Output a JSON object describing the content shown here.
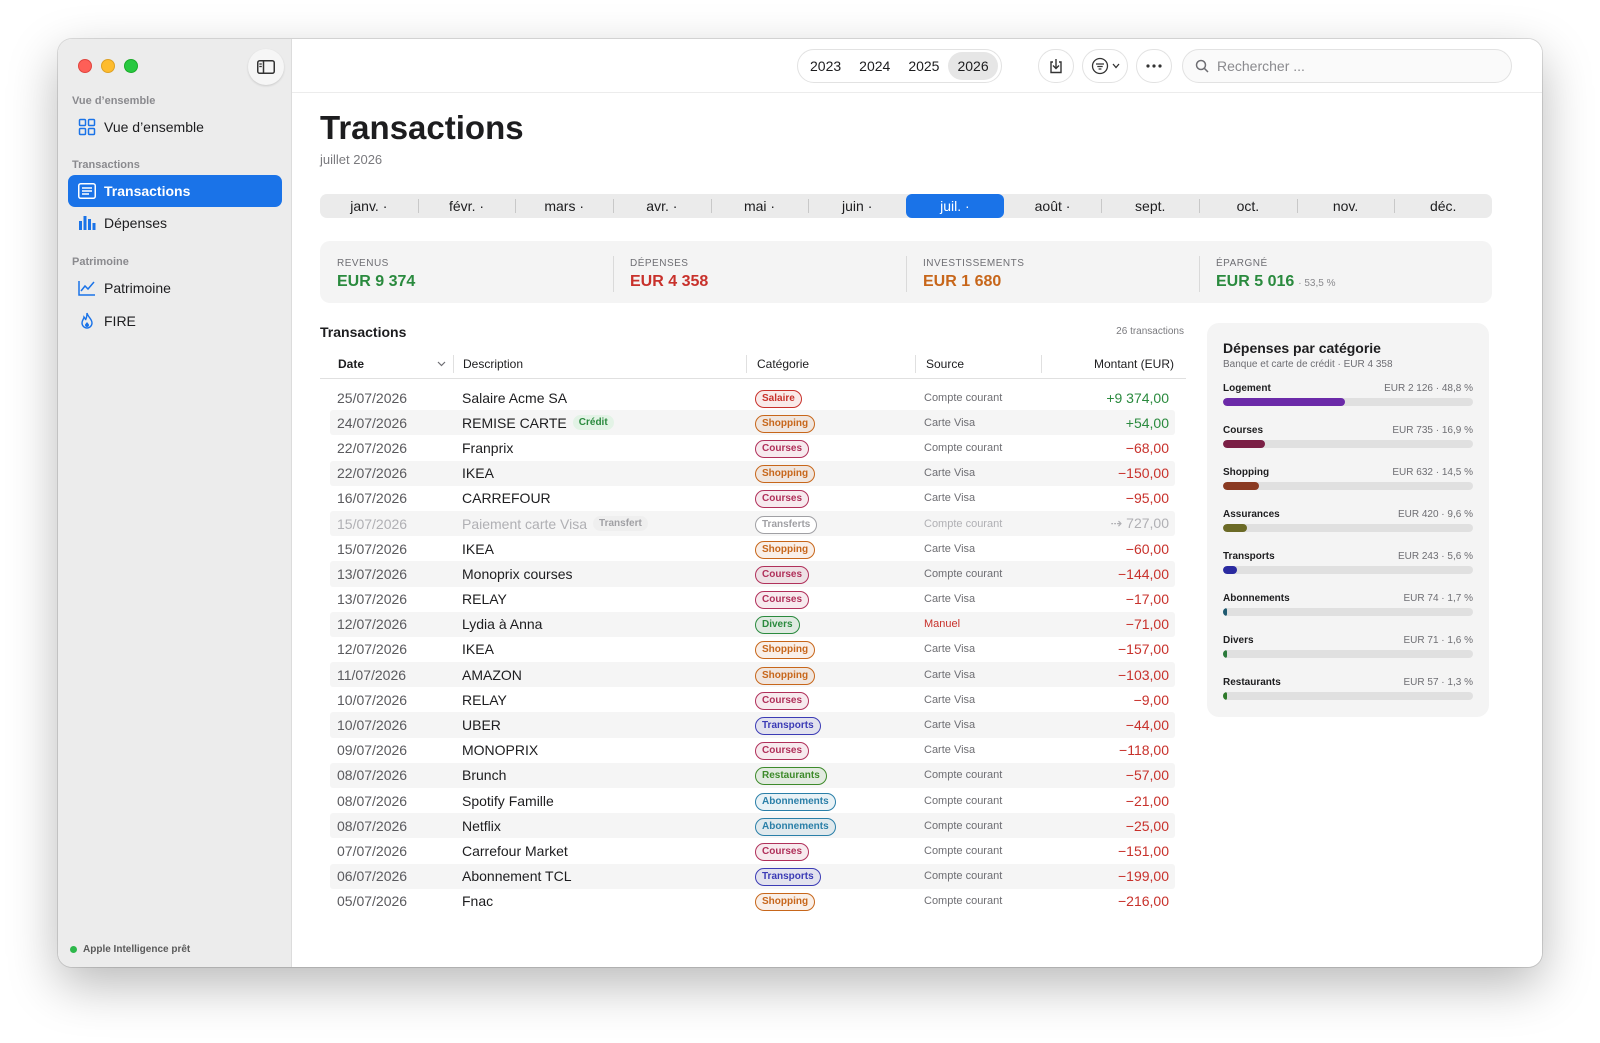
{
  "window": {
    "sidebar": {
      "sections": [
        {
          "label": "Vue d’ensemble",
          "items": [
            {
              "label": "Vue d’ensemble",
              "icon": "grid-icon"
            }
          ]
        },
        {
          "label": "Transactions",
          "items": [
            {
              "label": "Transactions",
              "icon": "list-icon",
              "active": true
            },
            {
              "label": "Dépenses",
              "icon": "bar-chart-icon"
            }
          ]
        },
        {
          "label": "Patrimoine",
          "items": [
            {
              "label": "Patrimoine",
              "icon": "line-chart-icon"
            },
            {
              "label": "FIRE",
              "icon": "flame-icon"
            }
          ]
        }
      ],
      "status": "Apple Intelligence prêt"
    },
    "toolbar": {
      "years": [
        "2023",
        "2024",
        "2025",
        "2026"
      ],
      "selected_year": "2026",
      "search_placeholder": "Rechercher ..."
    }
  },
  "page": {
    "title": "Transactions",
    "subtitle": "juillet 2026",
    "months": [
      "janv. ·",
      "févr. ·",
      "mars ·",
      "avr. ·",
      "mai ·",
      "juin ·",
      "juil. ·",
      "août ·",
      "sept.",
      "oct.",
      "nov.",
      "déc."
    ],
    "selected_month": "juil. ·"
  },
  "kpis": [
    {
      "label": "REVENUS",
      "value": "EUR 9 374",
      "color": "#2a8a3e",
      "extra": ""
    },
    {
      "label": "DÉPENSES",
      "value": "EUR 4 358",
      "color": "#c8312b",
      "extra": ""
    },
    {
      "label": "INVESTISSEMENTS",
      "value": "EUR 1 680",
      "color": "#c7661a",
      "extra": ""
    },
    {
      "label": "ÉPARGNÉ",
      "value": "EUR 5 016",
      "color": "#2a8a3e",
      "extra": "· 53,5 %"
    }
  ],
  "transactions": {
    "title": "Transactions",
    "count": "26 transactions",
    "columns": {
      "date": "Date",
      "description": "Description",
      "category": "Catégorie",
      "source": "Source",
      "amount": "Montant (EUR)"
    },
    "rows": [
      {
        "date": "25/07/2026",
        "desc": "Salaire Acme SA",
        "tag": "",
        "cat": "Salaire",
        "src": "Compte courant",
        "amt": "+9 374,00",
        "type": "in"
      },
      {
        "date": "24/07/2026",
        "desc": "REMISE CARTE",
        "tag": "Crédit",
        "cat": "Shopping",
        "src": "Carte Visa",
        "amt": "+54,00",
        "type": "in"
      },
      {
        "date": "22/07/2026",
        "desc": "Franprix",
        "tag": "",
        "cat": "Courses",
        "src": "Compte courant",
        "amt": "−68,00",
        "type": "out"
      },
      {
        "date": "22/07/2026",
        "desc": "IKEA",
        "tag": "",
        "cat": "Shopping",
        "src": "Carte Visa",
        "amt": "−150,00",
        "type": "out"
      },
      {
        "date": "16/07/2026",
        "desc": "CARREFOUR",
        "tag": "",
        "cat": "Courses",
        "src": "Carte Visa",
        "amt": "−95,00",
        "type": "out"
      },
      {
        "date": "15/07/2026",
        "desc": "Paiement carte Visa",
        "tag": "Transfert",
        "cat": "Transferts",
        "src": "Compte courant",
        "amt": "⇢ 727,00",
        "type": "transfer"
      },
      {
        "date": "15/07/2026",
        "desc": "IKEA",
        "tag": "",
        "cat": "Shopping",
        "src": "Carte Visa",
        "amt": "−60,00",
        "type": "out"
      },
      {
        "date": "13/07/2026",
        "desc": "Monoprix courses",
        "tag": "",
        "cat": "Courses",
        "src": "Compte courant",
        "amt": "−144,00",
        "type": "out"
      },
      {
        "date": "13/07/2026",
        "desc": "RELAY",
        "tag": "",
        "cat": "Courses",
        "src": "Carte Visa",
        "amt": "−17,00",
        "type": "out"
      },
      {
        "date": "12/07/2026",
        "desc": "Lydia à Anna",
        "tag": "",
        "cat": "Divers",
        "src": "Manuel",
        "amt": "−71,00",
        "type": "out"
      },
      {
        "date": "12/07/2026",
        "desc": "IKEA",
        "tag": "",
        "cat": "Shopping",
        "src": "Carte Visa",
        "amt": "−157,00",
        "type": "out"
      },
      {
        "date": "11/07/2026",
        "desc": "AMAZON",
        "tag": "",
        "cat": "Shopping",
        "src": "Carte Visa",
        "amt": "−103,00",
        "type": "out"
      },
      {
        "date": "10/07/2026",
        "desc": "RELAY",
        "tag": "",
        "cat": "Courses",
        "src": "Carte Visa",
        "amt": "−9,00",
        "type": "out"
      },
      {
        "date": "10/07/2026",
        "desc": "UBER",
        "tag": "",
        "cat": "Transports",
        "src": "Carte Visa",
        "amt": "−44,00",
        "type": "out"
      },
      {
        "date": "09/07/2026",
        "desc": "MONOPRIX",
        "tag": "",
        "cat": "Courses",
        "src": "Carte Visa",
        "amt": "−118,00",
        "type": "out"
      },
      {
        "date": "08/07/2026",
        "desc": "Brunch",
        "tag": "",
        "cat": "Restaurants",
        "src": "Compte courant",
        "amt": "−57,00",
        "type": "out"
      },
      {
        "date": "08/07/2026",
        "desc": "Spotify Famille",
        "tag": "",
        "cat": "Abonnements",
        "src": "Compte courant",
        "amt": "−21,00",
        "type": "out"
      },
      {
        "date": "08/07/2026",
        "desc": "Netflix",
        "tag": "",
        "cat": "Abonnements",
        "src": "Compte courant",
        "amt": "−25,00",
        "type": "out"
      },
      {
        "date": "07/07/2026",
        "desc": "Carrefour Market",
        "tag": "",
        "cat": "Courses",
        "src": "Compte courant",
        "amt": "−151,00",
        "type": "out"
      },
      {
        "date": "06/07/2026",
        "desc": "Abonnement TCL",
        "tag": "",
        "cat": "Transports",
        "src": "Compte courant",
        "amt": "−199,00",
        "type": "out"
      },
      {
        "date": "05/07/2026",
        "desc": "Fnac",
        "tag": "",
        "cat": "Shopping",
        "src": "Compte courant",
        "amt": "−216,00",
        "type": "out"
      }
    ]
  },
  "category_colors": {
    "Salaire": "#c8312b",
    "Shopping": "#c7661a",
    "Courses": "#b0305a",
    "Transferts": "#a0a0a4",
    "Divers": "#2a8a3e",
    "Transports": "#3b3bb5",
    "Restaurants": "#3d8a2a",
    "Abonnements": "#2a7fa8"
  },
  "spending_panel": {
    "title": "Dépenses par catégorie",
    "subtitle": "Banque et carte de crédit · EUR 4 358",
    "categories": [
      {
        "name": "Logement",
        "value": "EUR 2 126 · 48,8 %",
        "fraction": 0.488,
        "color": "#6b2aa8"
      },
      {
        "name": "Courses",
        "value": "EUR 735 · 16,9 %",
        "fraction": 0.169,
        "color": "#7a1f45"
      },
      {
        "name": "Shopping",
        "value": "EUR 632 · 14,5 %",
        "fraction": 0.145,
        "color": "#8a3a22"
      },
      {
        "name": "Assurances",
        "value": "EUR 420 · 9,6 %",
        "fraction": 0.096,
        "color": "#6b6a26"
      },
      {
        "name": "Transports",
        "value": "EUR 243 · 5,6 %",
        "fraction": 0.056,
        "color": "#2a2aa0"
      },
      {
        "name": "Abonnements",
        "value": "EUR 74 · 1,7 %",
        "fraction": 0.017,
        "color": "#1f5a70"
      },
      {
        "name": "Divers",
        "value": "EUR 71 · 1,6 %",
        "fraction": 0.016,
        "color": "#2a7a3a"
      },
      {
        "name": "Restaurants",
        "value": "EUR 57 · 1,3 %",
        "fraction": 0.013,
        "color": "#2e7a2a"
      }
    ]
  }
}
